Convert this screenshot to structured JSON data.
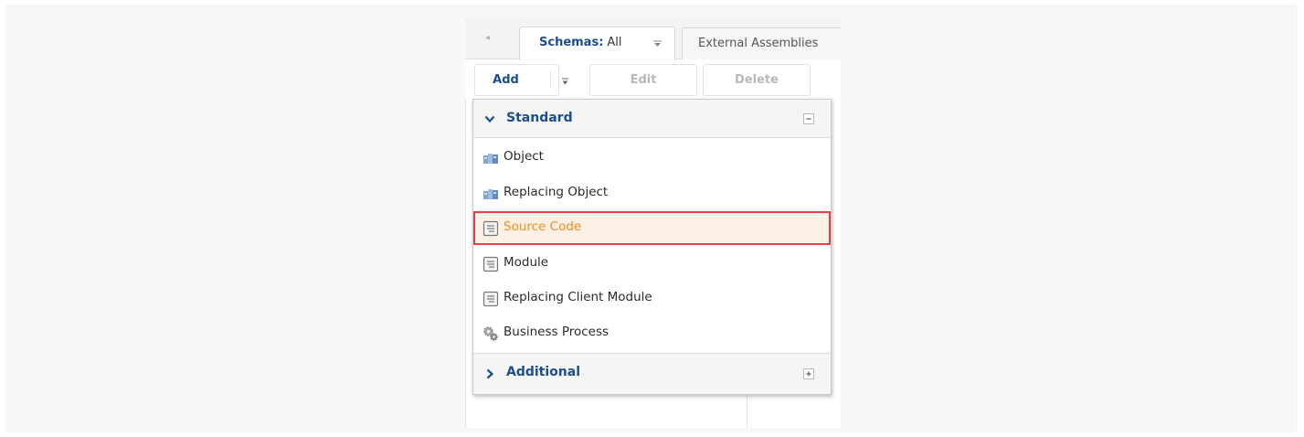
{
  "tabs": {
    "scroll_left": "◂",
    "schemas_name": "Schemas:",
    "schemas_value": "All",
    "external_label": "External Assemblies"
  },
  "toolbar": {
    "add_label": "Add",
    "edit_label": "Edit",
    "delete_label": "Delete"
  },
  "dropdown": {
    "groups": [
      {
        "title": "Standard",
        "expanded": true,
        "toggle_icon": "minus-box-icon",
        "items": [
          {
            "label": "Object",
            "icon": "object-cubes-icon",
            "highlighted": false
          },
          {
            "label": "Replacing Object",
            "icon": "object-cubes-icon",
            "highlighted": false
          },
          {
            "label": "Source Code",
            "icon": "document-icon",
            "highlighted": true
          },
          {
            "label": "Module",
            "icon": "document-icon",
            "highlighted": false
          },
          {
            "label": "Replacing Client Module",
            "icon": "document-icon",
            "highlighted": false
          },
          {
            "label": "Business Process",
            "icon": "gears-icon",
            "highlighted": false
          }
        ]
      },
      {
        "title": "Additional",
        "expanded": false,
        "toggle_icon": "plus-box-icon",
        "items": []
      }
    ]
  },
  "colors": {
    "accent": "#1c4d8c",
    "highlight_border": "#e5404a",
    "highlight_text": "#f28c1c",
    "highlight_bg": "#fdf1e6",
    "disabled_text": "#b9b9b9"
  }
}
